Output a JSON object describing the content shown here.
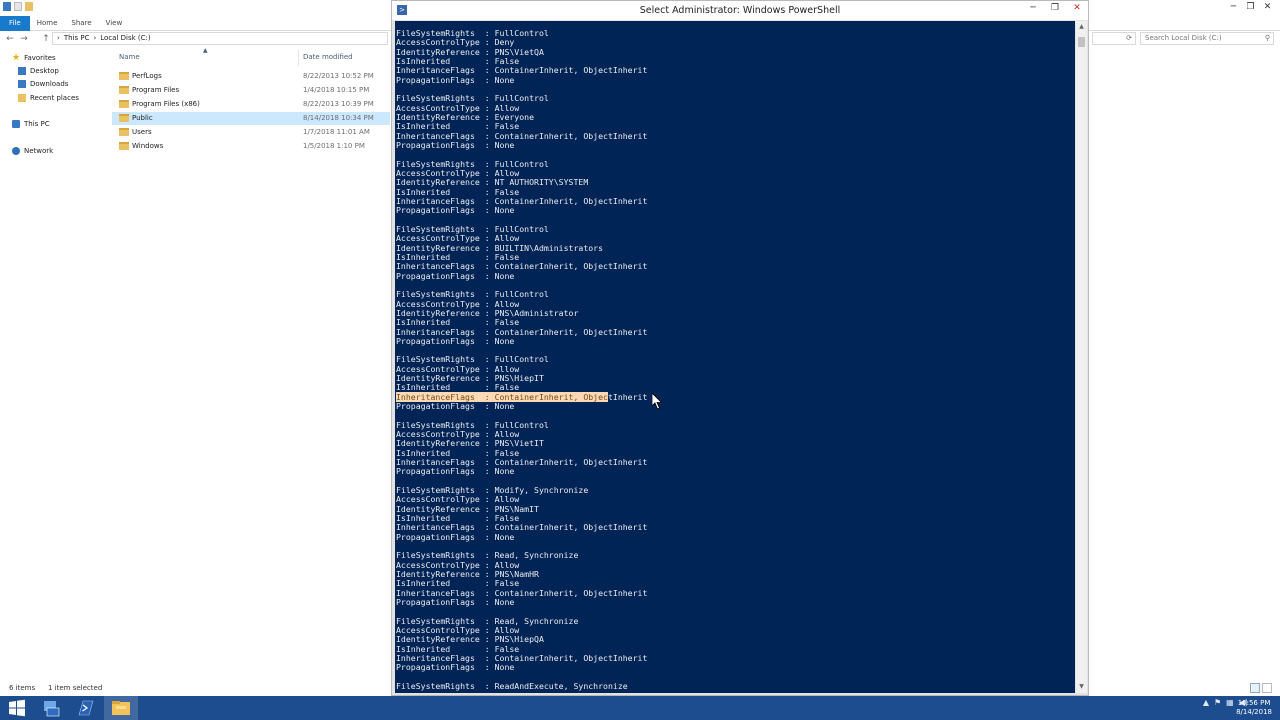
{
  "explorer": {
    "ribbon_tabs": [
      "File",
      "Home",
      "Share",
      "View"
    ],
    "breadcrumb": [
      "This PC",
      "Local Disk (C:)"
    ],
    "search_placeholder": "Search Local Disk (C:)",
    "columns": {
      "name": "Name",
      "date": "Date modified"
    },
    "nav": {
      "favorites": "Favorites",
      "desktop": "Desktop",
      "downloads": "Downloads",
      "recent": "Recent places",
      "this_pc": "This PC",
      "network": "Network"
    },
    "files": [
      {
        "name": "PerfLogs",
        "date": "8/22/2013 10:52 PM"
      },
      {
        "name": "Program Files",
        "date": "1/4/2018 10:15 PM"
      },
      {
        "name": "Program Files (x86)",
        "date": "8/22/2013 10:39 PM"
      },
      {
        "name": "Public",
        "date": "8/14/2018 10:34 PM"
      },
      {
        "name": "Users",
        "date": "1/7/2018 11:01 AM"
      },
      {
        "name": "Windows",
        "date": "1/5/2018 1:10 PM"
      }
    ],
    "status": {
      "count": "6 items",
      "selected": "1 item selected"
    }
  },
  "powershell": {
    "title": "Select Administrator: Windows PowerShell",
    "lines_before_highlight": "FileSystemRights  : FullControl\nAccessControlType : Deny\nIdentityReference : PNS\\VietQA\nIsInherited       : False\nInheritanceFlags  : ContainerInherit, ObjectInherit\nPropagationFlags  : None\n\nFileSystemRights  : FullControl\nAccessControlType : Allow\nIdentityReference : Everyone\nIsInherited       : False\nInheritanceFlags  : ContainerInherit, ObjectInherit\nPropagationFlags  : None\n\nFileSystemRights  : FullControl\nAccessControlType : Allow\nIdentityReference : NT AUTHORITY\\SYSTEM\nIsInherited       : False\nInheritanceFlags  : ContainerInherit, ObjectInherit\nPropagationFlags  : None\n\nFileSystemRights  : FullControl\nAccessControlType : Allow\nIdentityReference : BUILTIN\\Administrators\nIsInherited       : False\nInheritanceFlags  : ContainerInherit, ObjectInherit\nPropagationFlags  : None\n\nFileSystemRights  : FullControl\nAccessControlType : Allow\nIdentityReference : PNS\\Administrator\nIsInherited       : False\nInheritanceFlags  : ContainerInherit, ObjectInherit\nPropagationFlags  : None\n\nFileSystemRights  : FullControl\nAccessControlType : Allow\nIdentityReference : PNS\\HiepIT\nIsInherited       : False\n",
    "highlighted": "InheritanceFlags  : ContainerInherit, Objec",
    "after_highlight": "tInherit\nPropagationFlags  : None\n\nFileSystemRights  : FullControl\nAccessControlType : Allow\nIdentityReference : PNS\\VietIT\nIsInherited       : False\nInheritanceFlags  : ContainerInherit, ObjectInherit\nPropagationFlags  : None\n\nFileSystemRights  : Modify, Synchronize\nAccessControlType : Allow\nIdentityReference : PNS\\NamIT\nIsInherited       : False\nInheritanceFlags  : ContainerInherit, ObjectInherit\nPropagationFlags  : None\n\nFileSystemRights  : Read, Synchronize\nAccessControlType : Allow\nIdentityReference : PNS\\NamHR\nIsInherited       : False\nInheritanceFlags  : ContainerInherit, ObjectInherit\nPropagationFlags  : None\n\nFileSystemRights  : Read, Synchronize\nAccessControlType : Allow\nIdentityReference : PNS\\HiepQA\nIsInherited       : False\nInheritanceFlags  : ContainerInherit, ObjectInherit\nPropagationFlags  : None\n\nFileSystemRights  : ReadAndExecute, Synchronize"
  },
  "taskbar": {
    "time": "10:56 PM",
    "date": "8/14/2018"
  },
  "colors": {
    "console_bg": "#012456",
    "console_fg": "#eeedf0",
    "taskbar_bg": "#1d4d8e",
    "selection": "#cce8ff",
    "highlight": "#f9d9b6"
  },
  "icons": [
    "qat-icons",
    "folder-icon",
    "star-icon",
    "pc-icon",
    "network-icon",
    "powershell-icon",
    "windows-logo-icon",
    "explorer-icon",
    "mouse-cursor-icon"
  ]
}
